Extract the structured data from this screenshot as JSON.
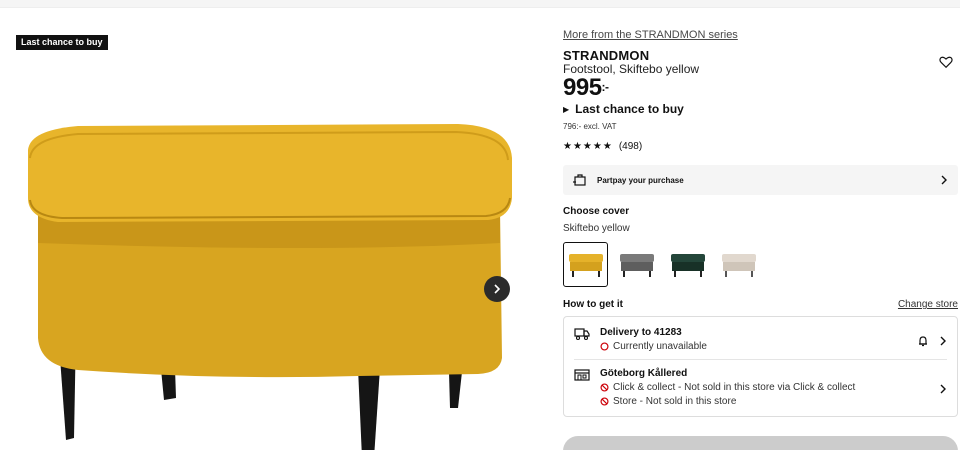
{
  "badge": "Last chance to buy",
  "series_link": "More from the STRANDMON series",
  "product": {
    "name": "STRANDMON",
    "description": "Footstool, Skiftebo yellow",
    "price_main": "995",
    "price_suffix": ":-",
    "status": "Last chance to buy",
    "vat": "796:- excl. VAT",
    "rating_stars": 4.5,
    "review_count": "(498)"
  },
  "partpay": {
    "label": "Partpay your purchase"
  },
  "cover": {
    "heading": "Choose cover",
    "selected": "Skiftebo yellow",
    "swatches": [
      {
        "name": "Skiftebo yellow",
        "color": "#e5b22a"
      },
      {
        "name": "grey pattern",
        "color": "#6f6f6f"
      },
      {
        "name": "dark green",
        "color": "#1f3b2e"
      },
      {
        "name": "beige",
        "color": "#d8cfc4"
      }
    ]
  },
  "how_to_get": {
    "heading": "How to get it",
    "change_store": "Change store",
    "delivery": {
      "title": "Delivery to 41283",
      "status": "Currently unavailable"
    },
    "store": {
      "title": "Göteborg Kållered",
      "line1": "Click & collect - Not sold in this store via Click & collect",
      "line2": "Store - Not sold in this store"
    }
  },
  "colors": {
    "yellow": "#e5b22a",
    "unavailable_red": "#cc0008",
    "dark": "#111111"
  }
}
